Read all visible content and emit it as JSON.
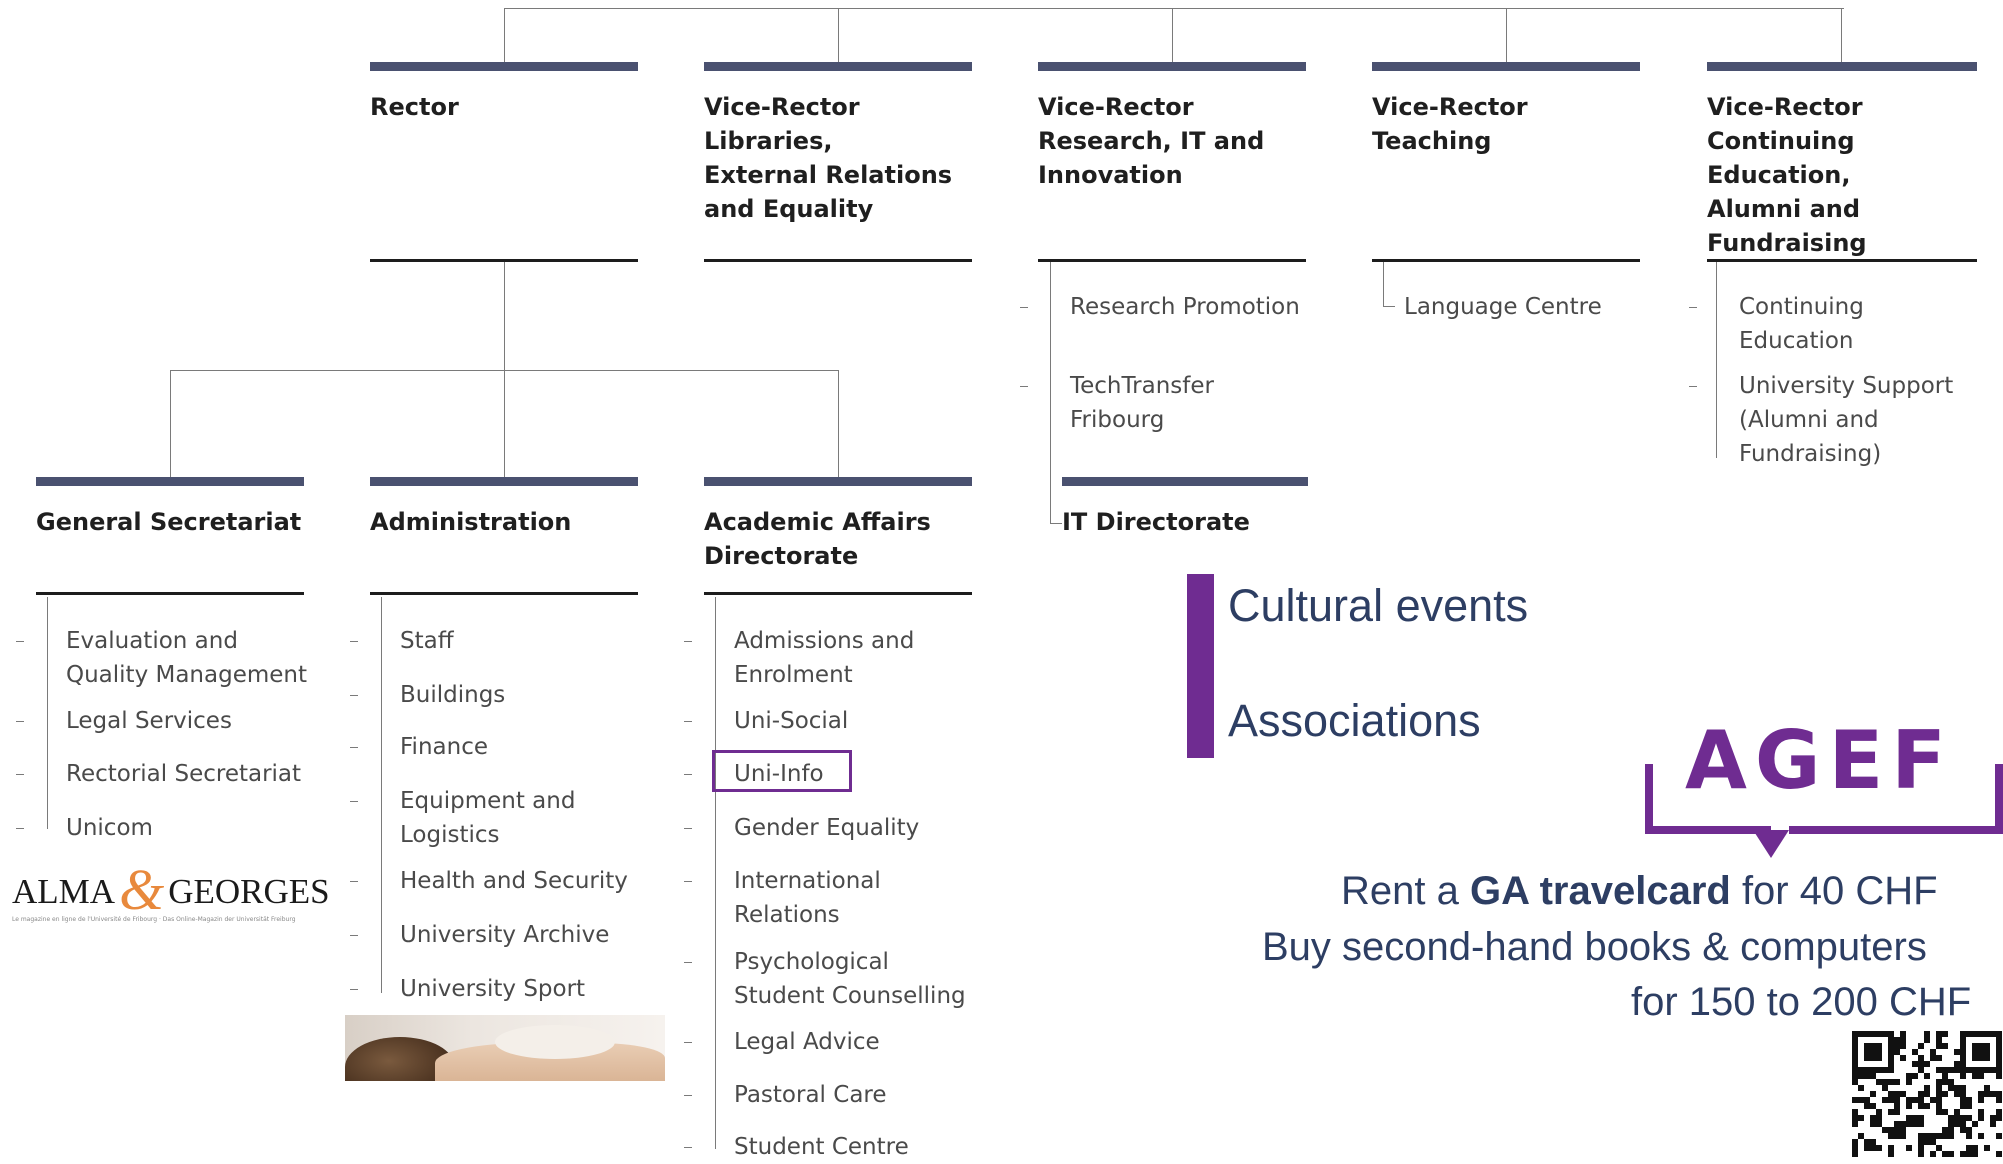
{
  "org": {
    "top_units": [
      {
        "id": "rector",
        "title": "Rector"
      },
      {
        "id": "vr-libraries",
        "title": "Vice-Rector\nLibraries,\nExternal Relations\nand Equality"
      },
      {
        "id": "vr-research",
        "title": "Vice-Rector\nResearch, IT and\nInnovation",
        "sub": [
          "Research Promotion",
          "TechTransfer\nFribourg"
        ]
      },
      {
        "id": "vr-teaching",
        "title": "Vice-Rector\nTeaching",
        "sub": [
          "Language Centre"
        ]
      },
      {
        "id": "vr-continuing",
        "title": "Vice-Rector\nContinuing Education,\nAlumni and\nFundraising",
        "sub": [
          "Continuing\nEducation",
          "University Support\n(Alumni and\nFundraising)"
        ]
      }
    ],
    "directorates": [
      {
        "id": "general-secretariat",
        "title": "General Secretariat",
        "sub": [
          "Evaluation and\nQuality Management",
          "Legal Services",
          "Rectorial Secretariat",
          "Unicom"
        ]
      },
      {
        "id": "administration",
        "title": "Administration",
        "sub": [
          "Staff",
          "Buildings",
          "Finance",
          "Equipment and\nLogistics",
          "Health and Security",
          "University Archive",
          "University Sport"
        ]
      },
      {
        "id": "academic-affairs",
        "title": "Academic Affairs\nDirectorate",
        "sub": [
          "Admissions and\nEnrolment",
          "Uni-Social",
          "Uni-Info",
          "Gender Equality",
          "International\nRelations",
          "Psychological\nStudent Counselling",
          "Legal Advice",
          "Pastoral Care",
          "Student Centre"
        ]
      },
      {
        "id": "it-directorate",
        "title": "IT Directorate"
      }
    ]
  },
  "highlighted_item": "Uni-Info",
  "logos": {
    "alma_georges": {
      "part1": "ALMA",
      "amp": "&",
      "part2": "GEORGES",
      "tagline": "Le magazine en ligne de l'Université de Fribourg · Das Online-Magazin der Universität Freiburg"
    },
    "agef": "AGEF"
  },
  "side_panel": {
    "line1": "Cultural events",
    "line2": "Associations"
  },
  "promo": {
    "line1_pre": "Rent a ",
    "line1_bold": "GA travelcard",
    "line1_post": " for 40 CHF",
    "line2": "Buy second-hand books & computers",
    "line3": "for 150 to 200 CHF"
  },
  "colors": {
    "header_bar": "#4a5170",
    "accent_purple": "#6f2c91",
    "promo_text": "#2d3e63"
  }
}
